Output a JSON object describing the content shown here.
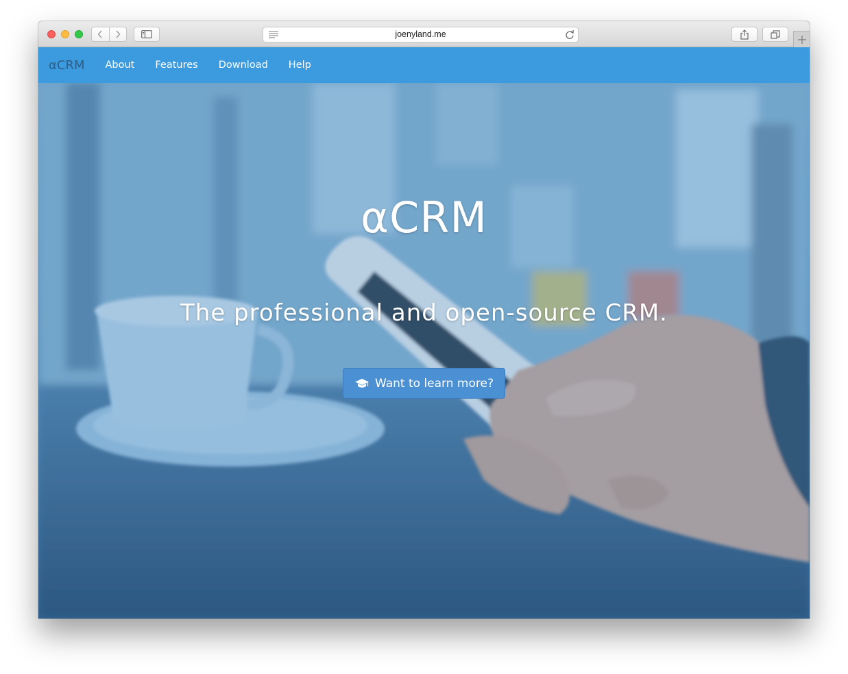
{
  "browser": {
    "url": "joenyland.me",
    "icons": {
      "back": "chevron-left-icon",
      "forward": "chevron-right-icon",
      "sidebar": "sidebar-icon",
      "reader": "reader-icon",
      "reload": "reload-icon",
      "share": "share-icon",
      "tabs": "tabs-overview-icon",
      "new_tab": "plus-icon"
    }
  },
  "navbar": {
    "brand": "αCRM",
    "links": [
      {
        "label": "About"
      },
      {
        "label": "Features"
      },
      {
        "label": "Download"
      },
      {
        "label": "Help"
      }
    ],
    "background_color": "#3c9ade"
  },
  "hero": {
    "title": "αCRM",
    "subtitle": "The professional and open-source CRM.",
    "cta": {
      "label": "Want to learn more?",
      "icon": "graduation-cap-icon",
      "color": "#4a90d2"
    }
  }
}
